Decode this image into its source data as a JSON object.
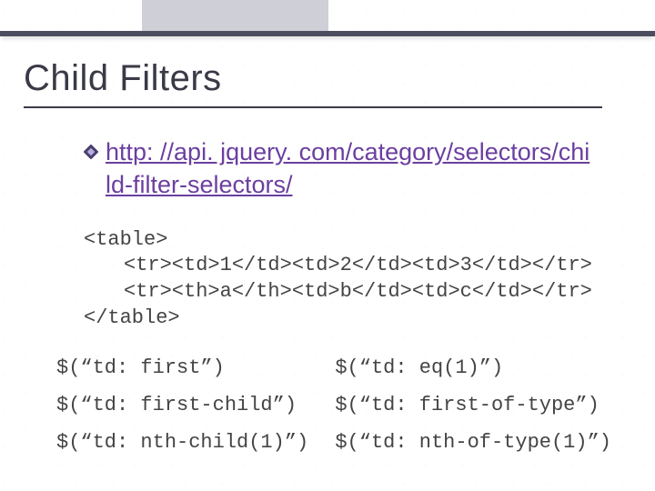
{
  "title": "Child Filters",
  "link": {
    "text": "http: //api. jquery. com/category/selectors/child-filter-selectors/",
    "color": "#6b3fa0"
  },
  "code_lines": [
    "<table>",
    "    <tr><td>1</td><td>2</td><td>3</td></tr>",
    "    <tr><th>a</th><td>b</td><td>c</td></tr>",
    "</table>"
  ],
  "selectors": [
    {
      "left": "$(“td: first”)",
      "right": "$(“td: eq(1)”)"
    },
    {
      "left": "$(“td: first-child”)",
      "right": "$(“td: first-of-type”)"
    },
    {
      "left": "$(“td: nth-child(1)”)",
      "right": "$(“td: nth-of-type(1)”)"
    }
  ]
}
